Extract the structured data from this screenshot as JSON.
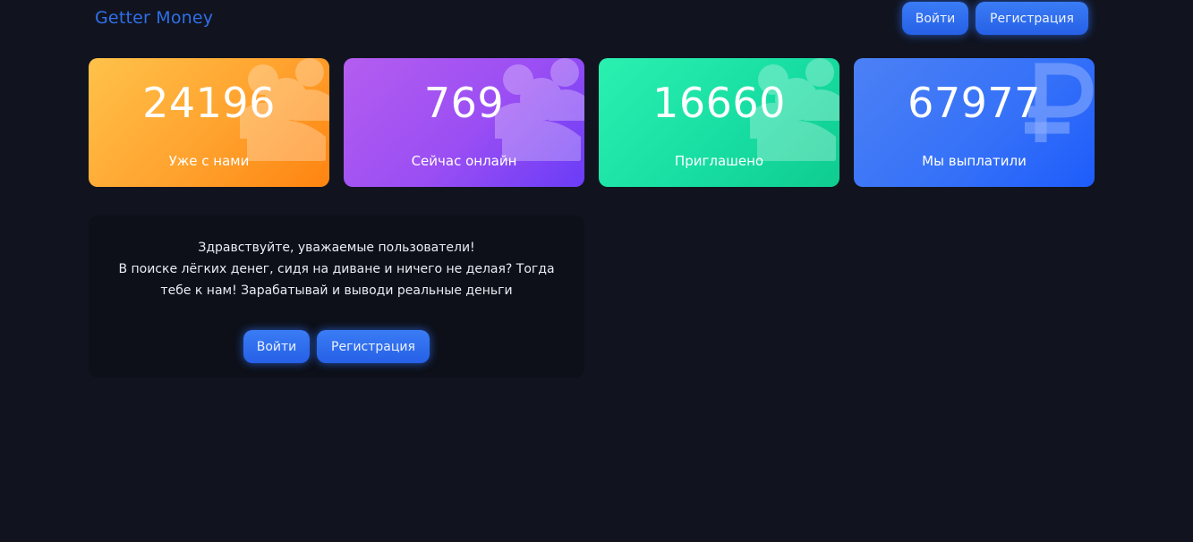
{
  "header": {
    "logo": "Getter Money",
    "login_label": "Войти",
    "register_label": "Регистрация"
  },
  "stats": [
    {
      "value": "24196",
      "label": "Уже с нами",
      "icon": "users-icon",
      "color_from": "#ffc24a",
      "color_to": "#ff8410"
    },
    {
      "value": "769",
      "label": "Сейчас онлайн",
      "icon": "users-icon",
      "color_from": "#b45df0",
      "color_to": "#6a3cf7"
    },
    {
      "value": "16660",
      "label": "Приглашено",
      "icon": "users-icon",
      "color_from": "#2af0b0",
      "color_to": "#0fcc8f"
    },
    {
      "value": "67977",
      "label": "Мы выплатили",
      "icon": "ruble-icon",
      "color_from": "#4c80f5",
      "color_to": "#1e5cfb"
    }
  ],
  "welcome": {
    "line1": "Здравствуйте, уважаемые пользователи!",
    "line2": "В поиске лёгких денег, сидя на диване и ничего не делая? Тогда",
    "line3": "тебе к нам! Зарабатывай и выводи реальные деньги",
    "login_label": "Войти",
    "register_label": "Регистрация"
  },
  "colors": {
    "background": "#11141f",
    "panel": "#0d1018",
    "accent": "#2f6fe9",
    "button": "#2f6ff0"
  }
}
